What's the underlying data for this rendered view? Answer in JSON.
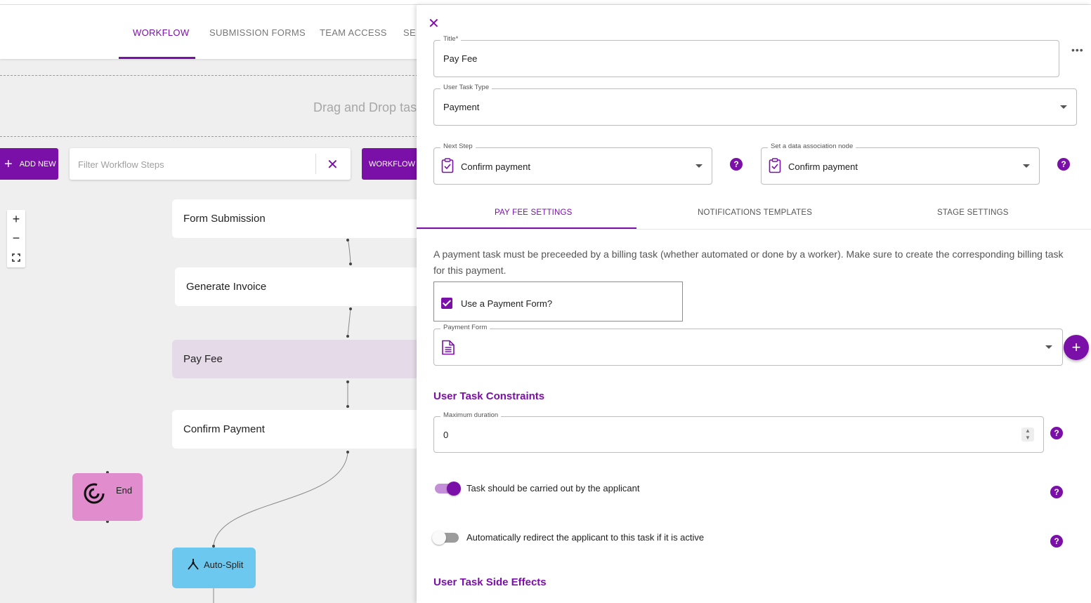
{
  "workflow": {
    "tabs": [
      "WORKFLOW",
      "SUBMISSION FORMS",
      "TEAM ACCESS",
      "SEF"
    ],
    "dropzone_text": "Drag and Drop task",
    "add_new_label": "ADD NEW",
    "filter_placeholder": "Filter Workflow Steps",
    "workflow_steps_label": "WORKFLOW ST",
    "nodes": {
      "form_submission": "Form Submission",
      "generate_invoice": "Generate Invoice",
      "pay_fee": "Pay Fee",
      "confirm_payment": "Confirm Payment",
      "end": "End",
      "auto_split": "Auto-Split"
    }
  },
  "panel": {
    "title_legend": "Title*",
    "title_value": "Pay Fee",
    "task_type_legend": "User Task Type",
    "task_type_value": "Payment",
    "next_step_legend": "Next Step",
    "next_step_value": "Confirm payment",
    "data_assoc_legend": "Set a data association node",
    "data_assoc_value": "Confirm payment",
    "tabs": [
      "PAY FEE SETTINGS",
      "NOTIFICATIONS TEMPLATES",
      "STAGE SETTINGS"
    ],
    "info_text": "A payment task must be preceeded by a billing task (whether automated or done by a worker). Make sure to create the corresponding billing task for this payment.",
    "use_payment_form_label": "Use a Payment Form?",
    "use_payment_form_checked": true,
    "payment_form_legend": "Payment Form",
    "constraints_title": "User Task Constraints",
    "max_duration_legend": "Maximum duration",
    "max_duration_value": "0",
    "toggle_applicant_label": "Task should be carried out by the applicant",
    "toggle_applicant_on": true,
    "toggle_redirect_label": "Automatically redirect the applicant to this task if it is active",
    "toggle_redirect_on": false,
    "side_effects_title": "User Task Side Effects"
  },
  "colors": {
    "accent": "#7b10a8",
    "end_node": "#e08ccd",
    "split_node": "#6cc8ef",
    "highlight": "#e8665a"
  }
}
